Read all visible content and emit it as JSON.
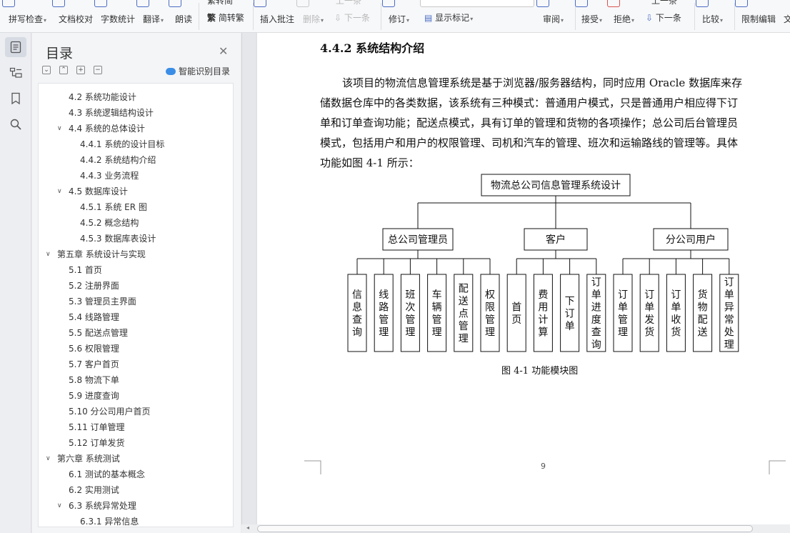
{
  "toolbar": {
    "spell": "拼写检查",
    "proof": "文档校对",
    "wordcount": "字数统计",
    "translate": "翻译",
    "read": "朗读",
    "traditional_top": "繁转简",
    "simplify": "简转繁",
    "insert_comment": "插入批注",
    "delete": "删除",
    "prev_top": "上一条",
    "next_comment": "下一条",
    "revise": "修订",
    "show_markup": "显示标记",
    "review": "审阅",
    "accept": "接受",
    "reject": "拒绝",
    "prev_change": "上一条",
    "next_change": "下一条",
    "compare": "比较",
    "restrict": "限制编辑",
    "text_cut": "文"
  },
  "toc": {
    "title": "目录",
    "smart_label": "智能识别目录",
    "items": [
      {
        "label": "4.2 系统功能设计",
        "level": 2,
        "arrow": ""
      },
      {
        "label": "4.3 系统逻辑结构设计",
        "level": 2,
        "arrow": ""
      },
      {
        "label": "4.4 系统的总体设计",
        "level": 2,
        "arrow": "∨"
      },
      {
        "label": "4.4.1 系统的设计目标",
        "level": 3,
        "arrow": ""
      },
      {
        "label": "4.4.2 系统结构介绍",
        "level": 3,
        "arrow": ""
      },
      {
        "label": "4.4.3 业务流程",
        "level": 3,
        "arrow": ""
      },
      {
        "label": "4.5  数据库设计",
        "level": 2,
        "arrow": "∨"
      },
      {
        "label": "4.5.1 系统 ER 图",
        "level": 3,
        "arrow": ""
      },
      {
        "label": "4.5.2  概念结构",
        "level": 3,
        "arrow": ""
      },
      {
        "label": "4.5.3  数据库表设计",
        "level": 3,
        "arrow": ""
      },
      {
        "label": "第五章  系统设计与实现",
        "level": 1,
        "arrow": "∨"
      },
      {
        "label": "5.1 首页",
        "level": 2,
        "arrow": ""
      },
      {
        "label": "5.2 注册界面",
        "level": 2,
        "arrow": ""
      },
      {
        "label": "5.3  管理员主界面",
        "level": 2,
        "arrow": ""
      },
      {
        "label": "5.4  线路管理",
        "level": 2,
        "arrow": ""
      },
      {
        "label": "5.5 配送点管理",
        "level": 2,
        "arrow": ""
      },
      {
        "label": "5.6  权限管理",
        "level": 2,
        "arrow": ""
      },
      {
        "label": "5.7  客户首页",
        "level": 2,
        "arrow": ""
      },
      {
        "label": "5.8  物流下单",
        "level": 2,
        "arrow": ""
      },
      {
        "label": "5.9  进度查询",
        "level": 2,
        "arrow": ""
      },
      {
        "label": "5.10  分公司用户首页",
        "level": 2,
        "arrow": ""
      },
      {
        "label": "5.11  订单管理",
        "level": 2,
        "arrow": ""
      },
      {
        "label": "5.12  订单发货",
        "level": 2,
        "arrow": ""
      },
      {
        "label": "第六章  系统测试",
        "level": 1,
        "arrow": "∨"
      },
      {
        "label": "6.1 测试的基本概念",
        "level": 2,
        "arrow": ""
      },
      {
        "label": "6.2 实用测试",
        "level": 2,
        "arrow": ""
      },
      {
        "label": "6.3 系统异常处理",
        "level": 2,
        "arrow": "∨"
      },
      {
        "label": "6.3.1 异常信息",
        "level": 3,
        "arrow": ""
      }
    ]
  },
  "document": {
    "heading": "4.4.2 系统结构介绍",
    "lines": [
      "该项目的物流信息管理系统是基于浏览器/服务器结构，同时应用 Oracle 数据库来存",
      "储数据仓库中的各类数据，该系统有三种模式：普通用户模式，只是普通用户相应得下订",
      "单和订单查询功能；配送点模式，具有订单的管理和货物的各项操作；总公司后台管理员",
      "模式，包括用户和用户的权限管理、司机和汽车的管理、班次和运输路线的管理等。具体",
      "功能如图 4-1 所示："
    ],
    "caption": "图 4-1   功能模块图",
    "page_number": "9"
  },
  "diagram": {
    "root": "物流总公司信息管理系统设计",
    "groups": [
      {
        "label": "总公司管理员",
        "leaves": [
          "信息查询",
          "线路管理",
          "班次管理",
          "车辆管理",
          "配送点管理",
          "权限管理"
        ]
      },
      {
        "label": "客户",
        "leaves": [
          "首页",
          "费用计算",
          "下订单",
          "订单进度查询"
        ]
      },
      {
        "label": "分公司用户",
        "leaves": [
          "订单管理",
          "订单发货",
          "订单收货",
          "货物配送",
          "订单异常处理"
        ]
      }
    ]
  }
}
